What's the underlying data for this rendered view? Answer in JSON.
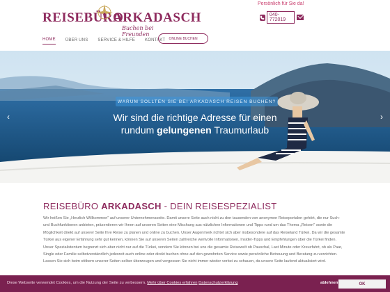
{
  "brand": {
    "name_left": "REISEBÜRO",
    "name_right": "ARKADASCH",
    "tagline": "Buchen bei Freunden"
  },
  "contact": {
    "tagline": "Persönlich für Sie da!",
    "phone": "040-772019"
  },
  "nav": {
    "items": [
      {
        "label": "HOME"
      },
      {
        "label": "ÜBER UNS"
      },
      {
        "label": "SERVICE & HILFE"
      },
      {
        "label": "KONTAKT"
      }
    ],
    "booking_label": "ONLINE BUCHEN"
  },
  "hero": {
    "kicker": "WARUM SOLLTEN SIE BEI ARKADASCH REISEN BUCHEN?",
    "line1": "Wir sind die richtige Adresse für einen",
    "line2_pre": "rundum ",
    "line2_bold": "gelungenen",
    "line2_post": " Traumurlaub"
  },
  "content": {
    "title_pre": "REISEBÜRO ",
    "title_bold": "ARKADASCH",
    "title_post": " - DEIN REISESPEZIALIST",
    "text": "Wir heißen Sie „Herzlich Willkommen\" auf unserer Unternehmensseite. Damit unsere Seite auch nicht zu den tausenden von anonymen Reiseportalen gehört, die nur Such- und Buchfunktionen anbieten, präsentieren wir Ihnen auf unseren Seiten eine Mischung aus nützlichen Informationen und Tipps rund um das Thema „Reisen\" sowie die Möglichkeit direkt auf unserer Seite Ihre Reise zu planen und online zu buchen. Unser Augenmerk richtet sich aber insbesondere auf das Reiseland Türkei. Da wir die gesamte Türkei aus eigener Erfahrung sehr gut kennen, können Sie auf unseren Seiten zahlreiche wertvolle Informationen, Insider-Tipps und Empfehlungen über die Türkei finden. Unser Spezialistentum begrenzt sich aber nicht nur auf die Türkei, sondern Sie können bei uns die gesamte Reisewelt ob Pauschal, Last Minute oder Kreuzfahrt, ob als Paar, Single oder Familie selbstverständlich jederzeit auch online oder direkt buchen ohne auf den gewohnten Service sowie persönliche Betreuung und Beratung zu verzichten. Lassen Sie sich beim stöbern unserer Seiten selber überzeugen und vergessen Sie nicht immer wieder vorbei zu schauen, da unsere Seite laufend aktualisiert wird."
  },
  "cookie": {
    "text": "Diese Webseite verwendet Cookies, um die Nutzung der Seite zu verbessern.",
    "link_more": "Mehr über Cookies erfahren",
    "link_privacy": "Datenschutzerklärung",
    "decline": "ablehnen",
    "ok": "OK"
  },
  "colors": {
    "brand": "#8e2b5e",
    "cookie_bar": "#7a2150"
  },
  "icons": [
    "compass-icon",
    "phone-icon",
    "mail-icon",
    "chevron-left-icon",
    "chevron-right-icon"
  ]
}
